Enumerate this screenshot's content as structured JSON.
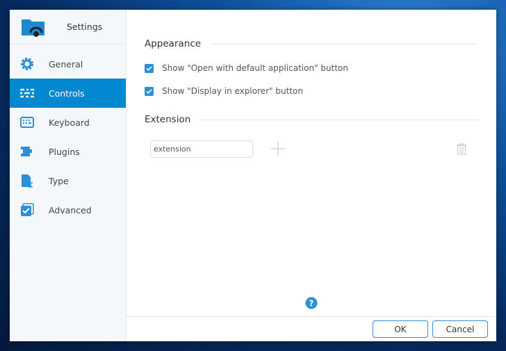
{
  "app": {
    "title": "Settings"
  },
  "sidebar": {
    "items": [
      {
        "label": "General",
        "icon": "gear-icon"
      },
      {
        "label": "Controls",
        "icon": "sliders-icon",
        "active": true
      },
      {
        "label": "Keyboard",
        "icon": "keyboard-icon"
      },
      {
        "label": "Plugins",
        "icon": "puzzle-icon"
      },
      {
        "label": "Type",
        "icon": "file-type-icon"
      },
      {
        "label": "Advanced",
        "icon": "checkbox-stack-icon"
      }
    ]
  },
  "main": {
    "appearance": {
      "title": "Appearance",
      "options": [
        {
          "label": "Show \"Open with default application\" button",
          "checked": true
        },
        {
          "label": "Show \"Display in explorer\" button",
          "checked": true
        }
      ]
    },
    "extension": {
      "title": "Extension",
      "input_value": "extension"
    }
  },
  "footer": {
    "ok": "OK",
    "cancel": "Cancel"
  },
  "colors": {
    "accent": "#0288d1"
  }
}
